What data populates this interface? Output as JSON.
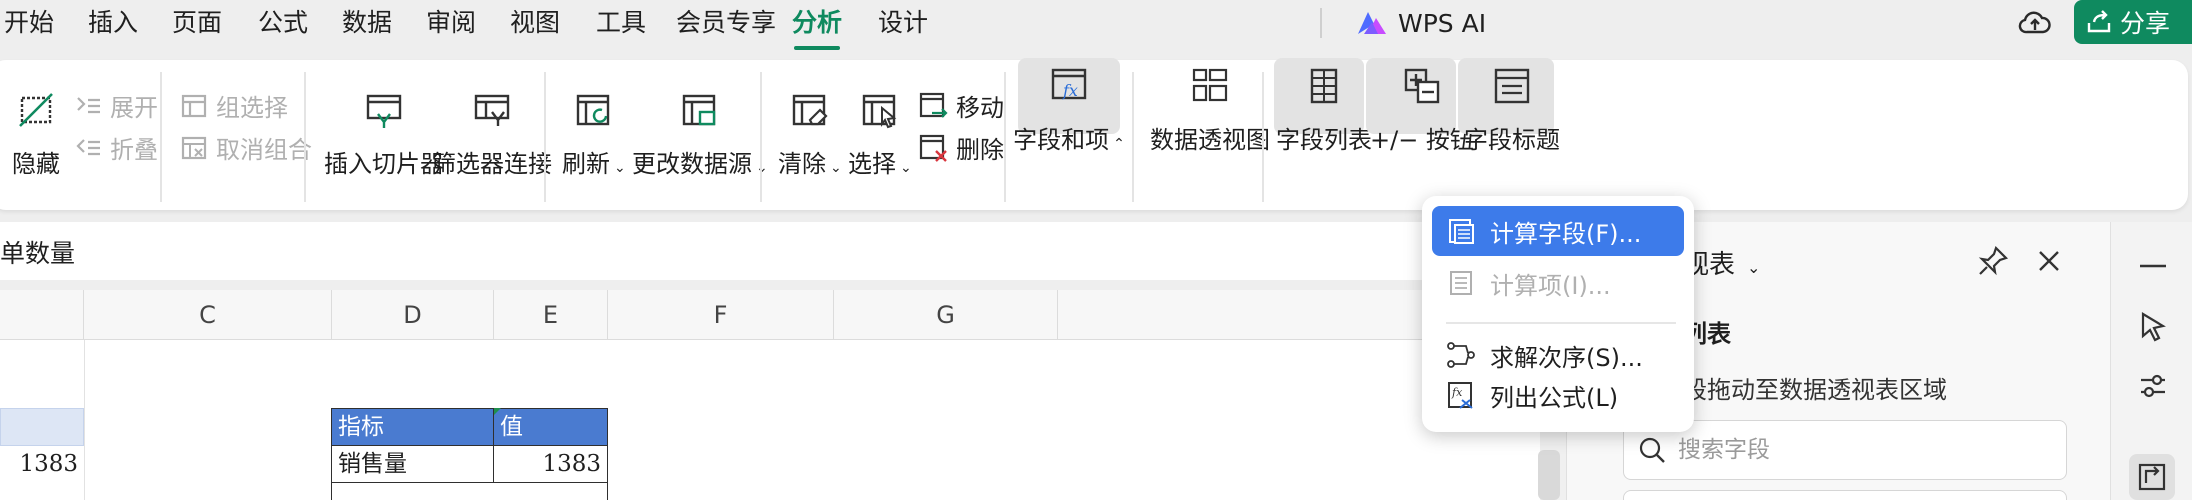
{
  "menu": {
    "tabs": [
      "开始",
      "插入",
      "页面",
      "公式",
      "数据",
      "审阅",
      "视图",
      "工具",
      "会员专享",
      "分析",
      "设计"
    ],
    "active_tab": "分析",
    "wps_ai": "WPS AI",
    "share": "分享"
  },
  "ribbon": {
    "hide": "隐藏",
    "expand": "展开",
    "collapse": "折叠",
    "group_select": "组选择",
    "ungroup": "取消组合",
    "insert_slicer": "插入切片器",
    "filter_connection": "筛选器连接",
    "refresh": "刷新",
    "change_source": "更改数据源",
    "clear": "清除",
    "select": "选择",
    "move": "移动",
    "delete": "删除",
    "fields_items": "字段和项",
    "pivot_chart": "数据透视图",
    "field_list": "字段列表",
    "plus_minus": "+/− 按钮",
    "field_header": "字段标题"
  },
  "formula_bar": {
    "text": "单数量"
  },
  "sheet": {
    "columns": [
      "C",
      "D",
      "E",
      "F",
      "G"
    ],
    "left_value": "1383",
    "table": {
      "header": [
        "指标",
        "值"
      ],
      "rows": [
        [
          "销售量",
          "1383"
        ]
      ]
    }
  },
  "panel": {
    "title": "视表",
    "subtitle": "列表",
    "hint": "段拖动至数据透视表区域",
    "search_placeholder": "搜索字段"
  },
  "dropdown": {
    "items": [
      {
        "label": "计算字段(F)...",
        "state": "active"
      },
      {
        "label": "计算项(I)...",
        "state": "disabled"
      },
      {
        "label": "求解次序(S)...",
        "state": "normal"
      },
      {
        "label": "列出公式(L)",
        "state": "normal"
      }
    ]
  },
  "colors": {
    "accent": "#0f8a5f",
    "table_header": "#4a7bd0",
    "selection": "#3d7bea",
    "selected_cell": "#dde6f5"
  }
}
